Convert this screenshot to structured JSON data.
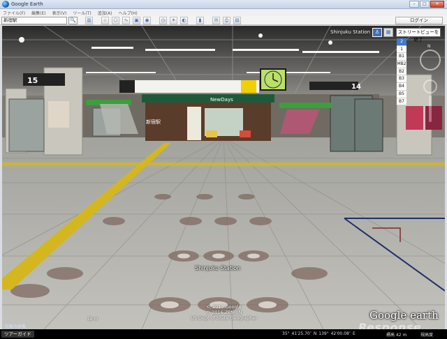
{
  "window": {
    "title": "Google Earth"
  },
  "menu": [
    "ファイル(F)",
    "編集(E)",
    "表示(V)",
    "ツール(T)",
    "追加(A)",
    "ヘルプ(H)"
  ],
  "search": {
    "value": "新宿駅",
    "button": "🔍"
  },
  "toolbar": {
    "icons": [
      "sidebar-icon",
      "placemark-icon",
      "polygon-icon",
      "path-icon",
      "overlay-icon",
      "tour-icon",
      "history-icon",
      "sun-icon",
      "planets-icon",
      "ruler-icon",
      "email-icon",
      "print-icon",
      "save-image-icon"
    ],
    "signin": "ログイン"
  },
  "streetview": {
    "station_label_top": "Shinjuku Station",
    "exit_button": "ストリートビューを終了",
    "floors": [
      "2",
      "1",
      "B1",
      "MB2",
      "B2",
      "B3",
      "B4",
      "B5",
      "B7"
    ],
    "active_floor": "2",
    "station_label_mid": "Shinjuku Station",
    "copyright": [
      "© 2017 Google",
      "© 2016 ZENRIN",
      "US Dept of State Geographer"
    ],
    "scale": "18 m",
    "overlay_label": "印象の画像",
    "brand": "Google earth",
    "watermark": "Response."
  },
  "scene_signs": {
    "kiosk": "NewDays",
    "station_sign": "新宿駅",
    "platform_14": "14",
    "platform_15": "15"
  },
  "status": {
    "tour": "ツアーガイド",
    "coords": "35° 41′25.70″ N 139° 42′00.08″ E",
    "elevation": "標高 42 m",
    "eye": "視高度"
  }
}
